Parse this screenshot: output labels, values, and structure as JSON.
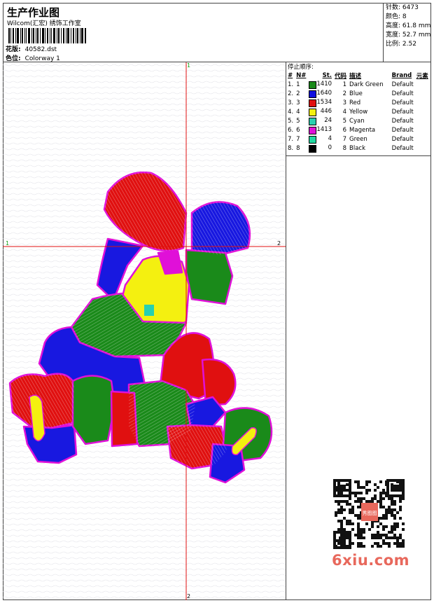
{
  "header": {
    "title": "生产作业图",
    "company": "Wilcom(汇宏) 绣饰工作室",
    "design_label": "花版:",
    "design_value": "40582.dst",
    "colorway_label": "色位:",
    "colorway_value": "Colorway 1"
  },
  "stats": [
    {
      "label": "针数:",
      "value": "6473"
    },
    {
      "label": "颜色:",
      "value": "8"
    },
    {
      "label": "高度:",
      "value": "61.8 mm"
    },
    {
      "label": "宽度:",
      "value": "52.7 mm"
    },
    {
      "label": "比例:",
      "value": "2.52"
    }
  ],
  "stop_sequence": {
    "title": "停止顺序:",
    "headers": [
      "#",
      "N#",
      "St.",
      "代码",
      "描述",
      "Brand",
      "元素"
    ],
    "rows": [
      {
        "idx": "1.",
        "n": "1",
        "color": "#1a8a1a",
        "st": "1410",
        "code": "1",
        "desc": "Dark Green",
        "brand": "Default"
      },
      {
        "idx": "2.",
        "n": "2",
        "color": "#1010e0",
        "st": "1640",
        "code": "2",
        "desc": "Blue",
        "brand": "Default"
      },
      {
        "idx": "3.",
        "n": "3",
        "color": "#e01010",
        "st": "1534",
        "code": "3",
        "desc": "Red",
        "brand": "Default"
      },
      {
        "idx": "4.",
        "n": "4",
        "color": "#f4f010",
        "st": "446",
        "code": "4",
        "desc": "Yellow",
        "brand": "Default"
      },
      {
        "idx": "5.",
        "n": "5",
        "color": "#28d0b0",
        "st": "24",
        "code": "5",
        "desc": "Cyan",
        "brand": "Default"
      },
      {
        "idx": "6.",
        "n": "6",
        "color": "#e010d8",
        "st": "1413",
        "code": "6",
        "desc": "Magenta",
        "brand": "Default"
      },
      {
        "idx": "7.",
        "n": "7",
        "color": "#20d8a0",
        "st": "4",
        "code": "7",
        "desc": "Green",
        "brand": "Default"
      },
      {
        "idx": "8.",
        "n": "8",
        "color": "#000000",
        "st": "0",
        "code": "8",
        "desc": "Black",
        "brand": "Default"
      }
    ]
  },
  "axes": {
    "top": "1",
    "left": "1",
    "right": "2",
    "bottom": "2"
  },
  "watermark": "6xiu.com",
  "qr_stamp": "秀图图"
}
